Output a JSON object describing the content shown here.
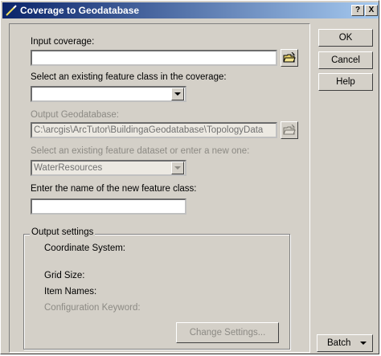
{
  "window": {
    "title": "Coverage to Geodatabase",
    "help_button": "?",
    "close_button": "X"
  },
  "form": {
    "input_coverage_label": "Input coverage:",
    "input_coverage_value": "",
    "feature_class_label": "Select an existing feature class in the coverage:",
    "feature_class_value": "",
    "output_gdb_label": "Output Geodatabase:",
    "output_gdb_value": "C:\\arcgis\\ArcTutor\\BuildingaGeodatabase\\TopologyData",
    "feature_dataset_label": "Select an existing feature dataset or enter a new one:",
    "feature_dataset_value": "WaterResources",
    "new_class_label": "Enter the name of the new feature class:",
    "new_class_value": ""
  },
  "output_settings": {
    "title": "Output settings",
    "coordinate_system": "Coordinate System:",
    "grid_size": "Grid Size:",
    "item_names": "Item Names:",
    "config_keyword": "Configuration Keyword:",
    "change_settings": "Change Settings..."
  },
  "buttons": {
    "ok": "OK",
    "cancel": "Cancel",
    "help": "Help",
    "batch": "Batch"
  }
}
